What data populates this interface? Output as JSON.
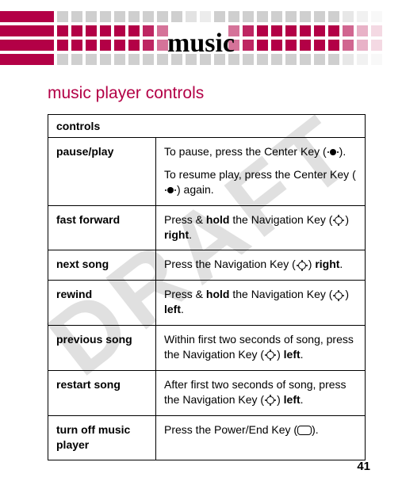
{
  "watermark": "DRAFT",
  "header_title": "music",
  "section_title": "music player controls",
  "table_header": "controls",
  "rows": [
    {
      "label": "pause/play",
      "desc_p1a": "To pause, press the Center Key (",
      "desc_p1b": ").",
      "desc_p2a": "To resume play, press the Center Key (",
      "desc_p2b": ") again.",
      "icon": "center"
    },
    {
      "label": "fast forward",
      "desc_a": "Press & ",
      "desc_bold1": "hold",
      "desc_b": " the Navigation Key (",
      "desc_c": ") ",
      "desc_bold2": "right",
      "desc_d": ".",
      "icon": "nav"
    },
    {
      "label": "next song",
      "desc_a": "Press the Navigation Key (",
      "desc_c": ") ",
      "desc_bold2": "right",
      "desc_d": ".",
      "icon": "nav"
    },
    {
      "label": "rewind",
      "desc_a": "Press & ",
      "desc_bold1": "hold",
      "desc_b": " the Navigation Key (",
      "desc_c": ") ",
      "desc_bold2": "left",
      "desc_d": ".",
      "icon": "nav"
    },
    {
      "label": "previous song",
      "desc_a": "Within first two seconds of song, press the Navigation Key (",
      "desc_c": ") ",
      "desc_bold2": "left",
      "desc_d": ".",
      "icon": "nav"
    },
    {
      "label": "restart song",
      "desc_a": "After first two seconds of song, press the Navigation Key (",
      "desc_c": ") ",
      "desc_bold2": "left",
      "desc_d": ".",
      "icon": "nav"
    },
    {
      "label": "turn off music player",
      "desc_a": "Press the Power/End Key (",
      "desc_d": ").",
      "icon": "end"
    }
  ],
  "page_number": "41"
}
